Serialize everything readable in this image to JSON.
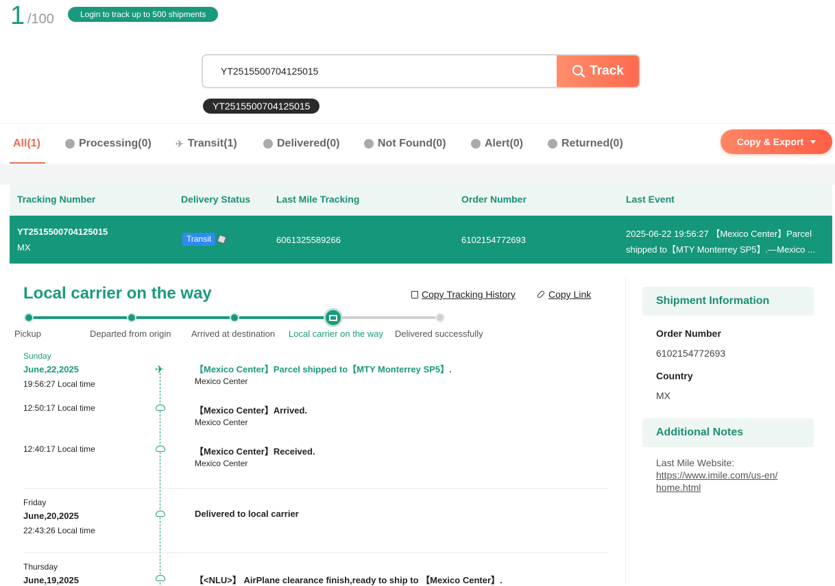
{
  "counter": {
    "current": "1",
    "total": "/100"
  },
  "login_pill": "Login to track up to 500 shipments",
  "search": {
    "value": "YT2515500704125015",
    "button": "Track"
  },
  "chip": "YT2515500704125015",
  "tabs": [
    {
      "label": "All(1)"
    },
    {
      "label": "Processing(0)"
    },
    {
      "label": "Transit(1)"
    },
    {
      "label": "Delivered(0)"
    },
    {
      "label": "Not Found(0)"
    },
    {
      "label": "Alert(0)"
    },
    {
      "label": "Returned(0)"
    }
  ],
  "export_label": "Copy & Export",
  "table": {
    "headers": [
      "Tracking Number",
      "Delivery Status",
      "Last Mile Tracking",
      "Order Number",
      "Last Event"
    ],
    "row": {
      "tracking": "YT2515500704125015",
      "country": "MX",
      "status": "Transit",
      "last_mile": "6061325589266",
      "order": "6102154772693",
      "last_event_1": "2025-06-22 19:56:27 【Mexico Center】Parcel",
      "last_event_2": "shipped to【MTY Monterrey SP5】.—Mexico ..."
    }
  },
  "detail": {
    "status_title": "Local carrier on the way",
    "copy_history": "Copy Tracking History",
    "copy_link": "Copy Link",
    "progress": {
      "fraction_complete": 0.75,
      "steps": [
        "Pickup",
        "Departed from origin",
        "Arrived at destination",
        "Local carrier on the way",
        "Delivered successfully"
      ]
    }
  },
  "timeline": {
    "g1": {
      "day": "Sunday",
      "date": "June,22,2025"
    },
    "e1": {
      "time": "19:56:27 Local time",
      "event": "【Mexico Center】Parcel shipped to【MTY Monterrey SP5】.",
      "location": "Mexico Center"
    },
    "e2": {
      "time": "12:50:17 Local time",
      "event": "【Mexico Center】Arrived.",
      "location": "Mexico Center"
    },
    "e3": {
      "time": "12:40:17 Local time",
      "event": "【Mexico Center】Received.",
      "location": "Mexico Center"
    },
    "g2": {
      "day": "Friday",
      "date": "June,20,2025"
    },
    "e4": {
      "time": "22:43:26 Local time",
      "event": "Delivered to local carrier"
    },
    "g3": {
      "day": "Thursday",
      "date": "June,19,2025"
    },
    "e5": {
      "event": "【<NLU>】 AirPlane clearance finish,ready to ship to 【Mexico Center】."
    }
  },
  "shipment_info": {
    "title": "Shipment Information",
    "order_label": "Order Number",
    "order_value": "6102154772693",
    "country_label": "Country",
    "country_value": "MX"
  },
  "notes": {
    "title": "Additional Notes",
    "label": "Last Mile Website:",
    "url": "https://www.imile.com/us-en/home.html"
  },
  "colors": {
    "brand": "#1a9a7c",
    "accent": "#ef6a52",
    "badge": "#2e8bf0"
  }
}
